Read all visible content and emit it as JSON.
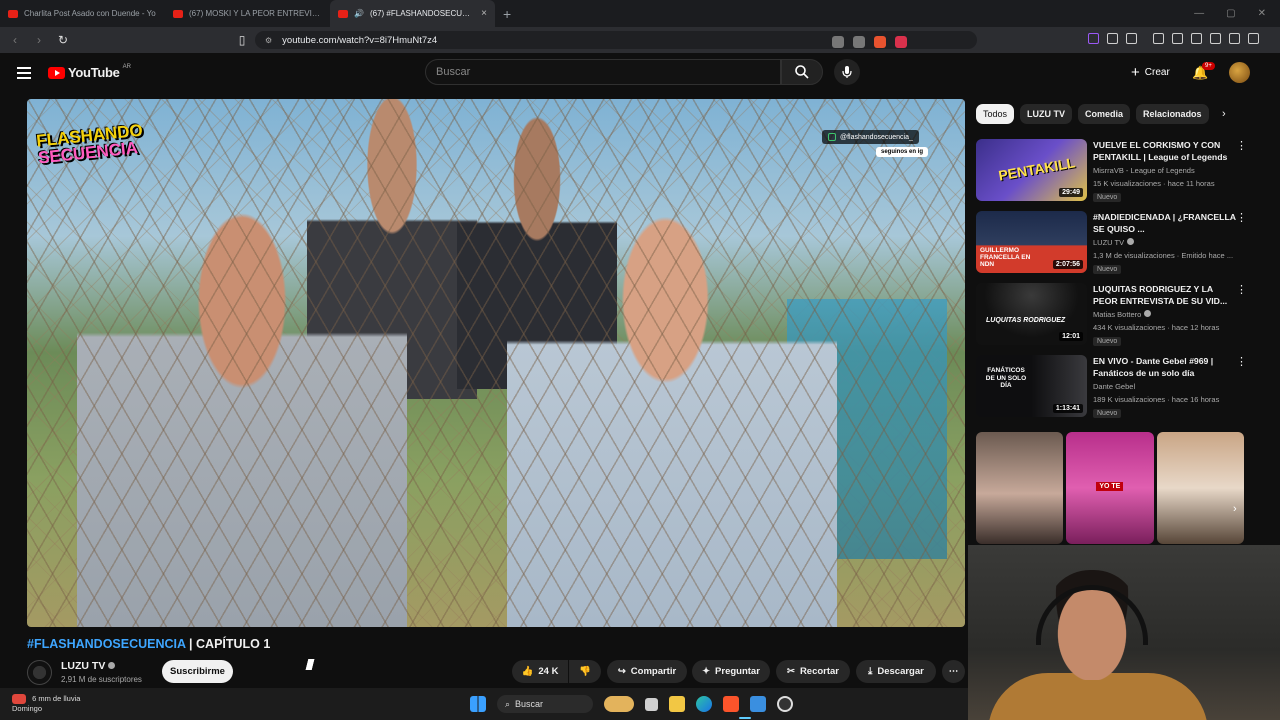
{
  "browser": {
    "tabs": [
      {
        "title": "Charlita Post Asado con Duende - Yo",
        "active": false
      },
      {
        "title": "(67) MOSKI Y LA PEOR ENTREVISTA",
        "active": false
      },
      {
        "title": "(67) #FLASHANDOSECUENCIA",
        "active": true
      }
    ],
    "new_tab": "+",
    "url": "youtube.com/watch?v=8i7HmuNt7z4"
  },
  "youtube": {
    "logo_text": "YouTube",
    "country_code": "AR",
    "search_placeholder": "Buscar",
    "create_label": "Crear",
    "notifications_badge": "9+"
  },
  "player": {
    "show_logo_line1": "FLASHANDO",
    "show_logo_line2": "SECUENCIA",
    "ig_handle": "@flashandosecuencia_",
    "ig_follow": "seguinos en ig"
  },
  "video": {
    "title_hashtag": "#FLASHANDOSECUENCIA",
    "title_rest": " | CAPÍTULO 1",
    "channel_name": "LUZU TV",
    "subscribers": "2,91 M de suscriptores",
    "subscribe_label": "Suscribirme",
    "likes": "24 K",
    "share_label": "Compartir",
    "ask_label": "Preguntar",
    "clip_label": "Recortar",
    "download_label": "Descargar"
  },
  "filters": {
    "chips": [
      "Todos",
      "LUZU TV",
      "Comedia",
      "Relacionados"
    ]
  },
  "recommendations": [
    {
      "title": "VUELVE EL CORKISMO Y CON PENTAKILL | League of Legends",
      "channel": "MisrraVB - League of Legends",
      "meta": "15 K visualizaciones · hace 11 horas",
      "duration": "29:49",
      "badge": "Nuevo",
      "thumb_text": "PENTAKILL",
      "color_a": "#3b2f8a",
      "color_b": "#e0c247"
    },
    {
      "title": "#NADIEDICENADA | ¿FRANCELLA SE QUISO ...",
      "channel": "LUZU TV",
      "meta": "1,3 M de visualizaciones · Emitido hace ...",
      "duration": "2:07:56",
      "badge": "Nuevo",
      "thumb_text": "GUILLERMO FRANCELLA EN NDN",
      "color_a": "#1c2a4a",
      "color_b": "#d23b2b"
    },
    {
      "title": "LUQUITAS RODRIGUEZ Y LA PEOR ENTREVISTA DE SU VID...",
      "channel": "Matias Bottero",
      "meta": "434 K visualizaciones · hace 12 horas",
      "duration": "12:01",
      "badge": "Nuevo",
      "thumb_text": "LUQUITAS RODRIGUEZ",
      "color_a": "#111111",
      "color_b": "#2f2f2f"
    },
    {
      "title": "EN VIVO - Dante Gebel #969 | Fanáticos de un solo día",
      "channel": "Dante Gebel",
      "meta": "189 K visualizaciones · hace 16 horas",
      "duration": "1:13:41",
      "badge": "Nuevo",
      "thumb_text": "FANÁTICOS DE UN SOLO DÍA",
      "color_a": "#0e0e10",
      "color_b": "#3a3a3e"
    }
  ],
  "shorts_caption": "YO TE",
  "taskbar": {
    "weather_line1": "6 mm de lluvia",
    "weather_line2": "Domingo",
    "search_label": "Buscar"
  }
}
